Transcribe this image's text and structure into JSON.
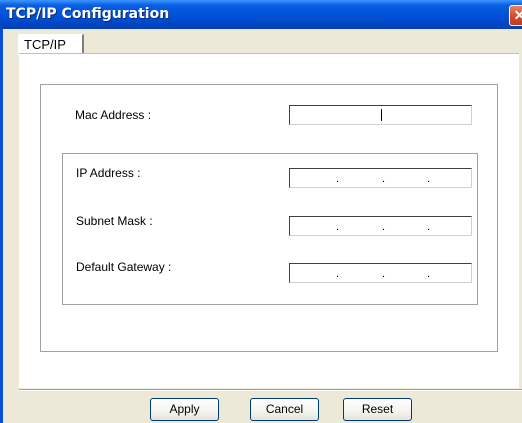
{
  "window": {
    "title": "TCP/IP Configuration",
    "close_glyph": "✕"
  },
  "tabs": [
    {
      "label": "TCP/IP",
      "selected": true
    }
  ],
  "form": {
    "mac_address_label": "Mac Address :",
    "mac_address_value": "",
    "ip_address_label": "IP Address :",
    "subnet_mask_label": "Subnet Mask :",
    "default_gateway_label": "Default Gateway :",
    "ip_separator": "."
  },
  "buttons": {
    "apply": "Apply",
    "cancel": "Cancel",
    "reset": "Reset"
  },
  "colors": {
    "titlebar": "#0052d9",
    "dialog_face": "#ece9d8",
    "close_button": "#d6492a"
  },
  "icons": {
    "close": "close-icon"
  }
}
